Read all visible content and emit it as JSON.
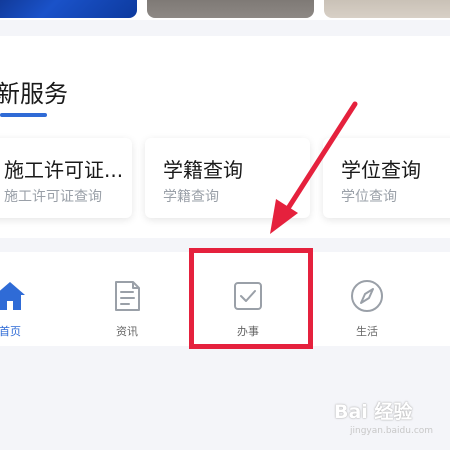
{
  "section": {
    "title": "新服务"
  },
  "cards": [
    {
      "title": "施工许可证...",
      "subtitle": "施工许可证查询"
    },
    {
      "title": "学籍查询",
      "subtitle": "学籍查询"
    },
    {
      "title": "学位查询",
      "subtitle": "学位查询"
    }
  ],
  "tabbar": {
    "items": [
      {
        "label": "首页",
        "icon": "home-icon",
        "active": true
      },
      {
        "label": "资讯",
        "icon": "document-icon",
        "active": false
      },
      {
        "label": "办事",
        "icon": "checkbox-icon",
        "active": false
      },
      {
        "label": "生活",
        "icon": "compass-icon",
        "active": false
      }
    ]
  },
  "watermark": {
    "brand": "Bai 经验",
    "url": "jingyan.baidu.com"
  },
  "colors": {
    "accent": "#2f6bd6",
    "annotation": "#e5213d",
    "inactive_icon": "#9aa0a8"
  }
}
